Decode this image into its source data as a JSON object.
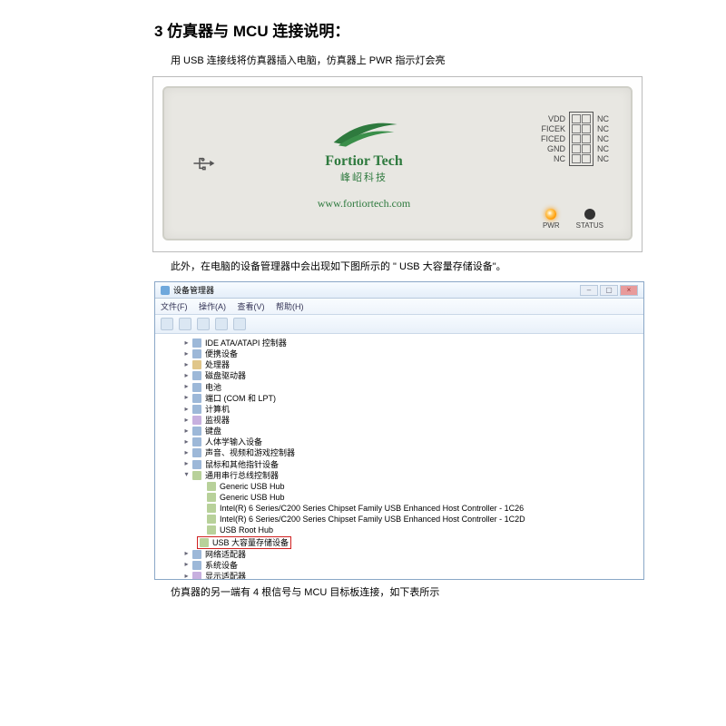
{
  "heading": "3 仿真器与 MCU 连接说明：",
  "para1": "用 USB 连接线将仿真器插入电脑，仿真器上 PWR 指示灯会亮",
  "para2": "此外，在电脑的设备管理器中会出现如下图所示的 \" USB 大容量存储设备\"。",
  "para3": "仿真器的另一端有 4 根信号与 MCU 目标板连接，如下表所示",
  "device": {
    "logo_line1": "Fortior Tech",
    "logo_line2": "峰岹科技",
    "url": "www.fortiortech.com",
    "pins_left": [
      "VDD",
      "FICEK",
      "FICED",
      "GND",
      "NC"
    ],
    "pins_right": [
      "NC",
      "NC",
      "NC",
      "NC",
      "NC"
    ],
    "led_pwr": "PWR",
    "led_status": "STATUS"
  },
  "devmgr": {
    "title": "设备管理器",
    "menu": {
      "file": "文件(F)",
      "action": "操作(A)",
      "view": "查看(V)",
      "help": "帮助(H)"
    },
    "root": "▸",
    "nodes": [
      {
        "lvl": 1,
        "exp": "▸",
        "ico": "dev",
        "label": "IDE ATA/ATAPI 控制器"
      },
      {
        "lvl": 1,
        "exp": "▸",
        "ico": "dev",
        "label": "便携设备"
      },
      {
        "lvl": 1,
        "exp": "▸",
        "ico": "cpu",
        "label": "处理器"
      },
      {
        "lvl": 1,
        "exp": "▸",
        "ico": "dev",
        "label": "磁盘驱动器"
      },
      {
        "lvl": 1,
        "exp": "▸",
        "ico": "dev",
        "label": "电池"
      },
      {
        "lvl": 1,
        "exp": "▸",
        "ico": "dev",
        "label": "端口 (COM 和 LPT)"
      },
      {
        "lvl": 1,
        "exp": "▸",
        "ico": "dev",
        "label": "计算机"
      },
      {
        "lvl": 1,
        "exp": "▸",
        "ico": "mon",
        "label": "监视器"
      },
      {
        "lvl": 1,
        "exp": "▸",
        "ico": "dev",
        "label": "键盘"
      },
      {
        "lvl": 1,
        "exp": "▸",
        "ico": "dev",
        "label": "人体学输入设备"
      },
      {
        "lvl": 1,
        "exp": "▸",
        "ico": "dev",
        "label": "声音、视频和游戏控制器"
      },
      {
        "lvl": 1,
        "exp": "▸",
        "ico": "dev",
        "label": "鼠标和其他指针设备"
      },
      {
        "lvl": 1,
        "exp": "▾",
        "ico": "usb",
        "label": "通用串行总线控制器"
      },
      {
        "lvl": 2,
        "exp": "",
        "ico": "usb",
        "label": "Generic USB Hub"
      },
      {
        "lvl": 2,
        "exp": "",
        "ico": "usb",
        "label": "Generic USB Hub"
      },
      {
        "lvl": 2,
        "exp": "",
        "ico": "usb",
        "label": "Intel(R) 6 Series/C200 Series Chipset Family USB Enhanced Host Controller - 1C26"
      },
      {
        "lvl": 2,
        "exp": "",
        "ico": "usb",
        "label": "Intel(R) 6 Series/C200 Series Chipset Family USB Enhanced Host Controller - 1C2D"
      },
      {
        "lvl": 2,
        "exp": "",
        "ico": "usb",
        "label": "USB Root Hub"
      }
    ],
    "highlight": "USB 大容量存储设备",
    "nodes_after": [
      {
        "lvl": 1,
        "exp": "▸",
        "ico": "dev",
        "label": "网络适配器"
      },
      {
        "lvl": 1,
        "exp": "▸",
        "ico": "dev",
        "label": "系统设备"
      },
      {
        "lvl": 1,
        "exp": "▸",
        "ico": "mon",
        "label": "显示适配器"
      }
    ]
  }
}
